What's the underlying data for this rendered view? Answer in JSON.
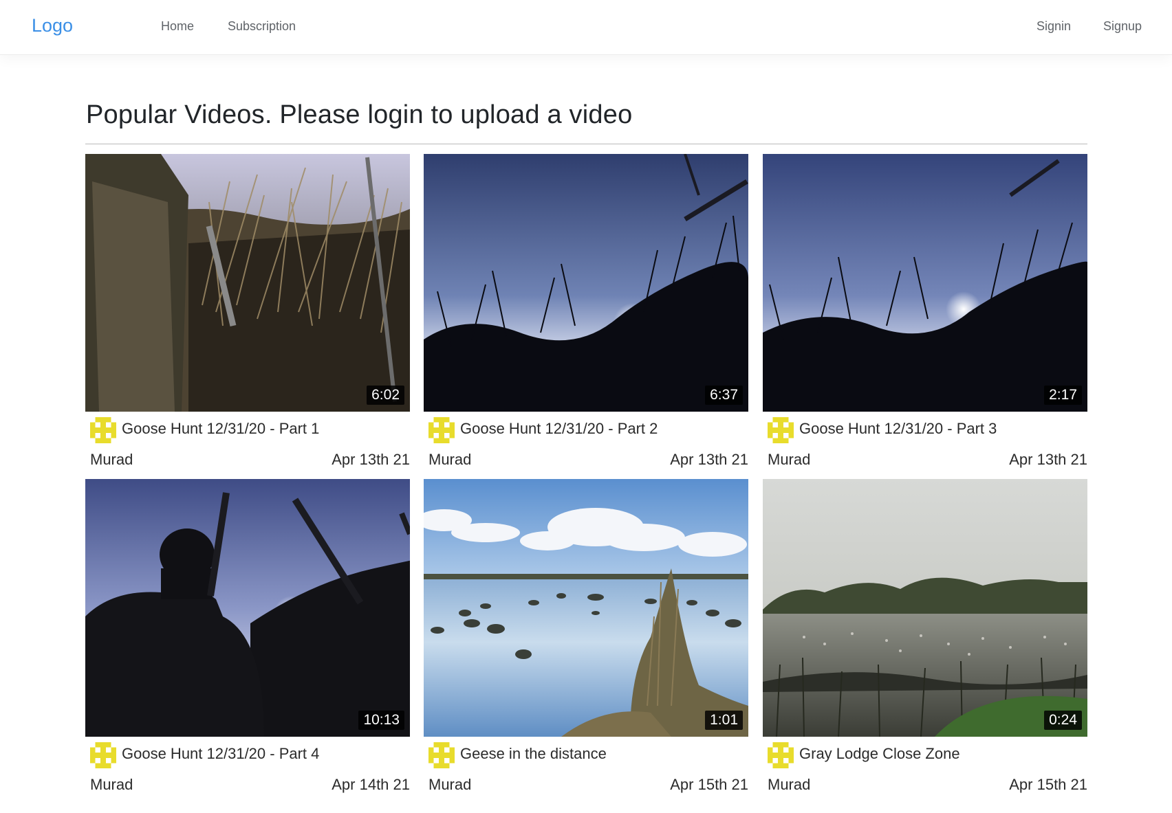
{
  "nav": {
    "brand": "Logo",
    "links": [
      "Home",
      "Subscription"
    ],
    "auth": [
      "Signin",
      "Signup"
    ]
  },
  "page": {
    "title": "Popular Videos. Please login to upload a video"
  },
  "videos": [
    {
      "title": "Goose Hunt 12/31/20 - Part 1",
      "duration": "6:02",
      "author": "Murad",
      "date": "Apr 13th 21"
    },
    {
      "title": "Goose Hunt 12/31/20 - Part 2",
      "duration": "6:37",
      "author": "Murad",
      "date": "Apr 13th 21"
    },
    {
      "title": "Goose Hunt 12/31/20 - Part 3",
      "duration": "2:17",
      "author": "Murad",
      "date": "Apr 13th 21"
    },
    {
      "title": "Goose Hunt 12/31/20 - Part 4",
      "duration": "10:13",
      "author": "Murad",
      "date": "Apr 14th 21"
    },
    {
      "title": "Geese in the distance",
      "duration": "1:01",
      "author": "Murad",
      "date": "Apr 15th 21"
    },
    {
      "title": "Gray Lodge Close Zone",
      "duration": "0:24",
      "author": "Murad",
      "date": "Apr 15th 21"
    }
  ],
  "colors": {
    "brand": "#3b8fe6",
    "avatar": "#e8dc2c",
    "duration_bg": "#000000"
  },
  "icons": {
    "avatar": "pixel-identicon"
  }
}
